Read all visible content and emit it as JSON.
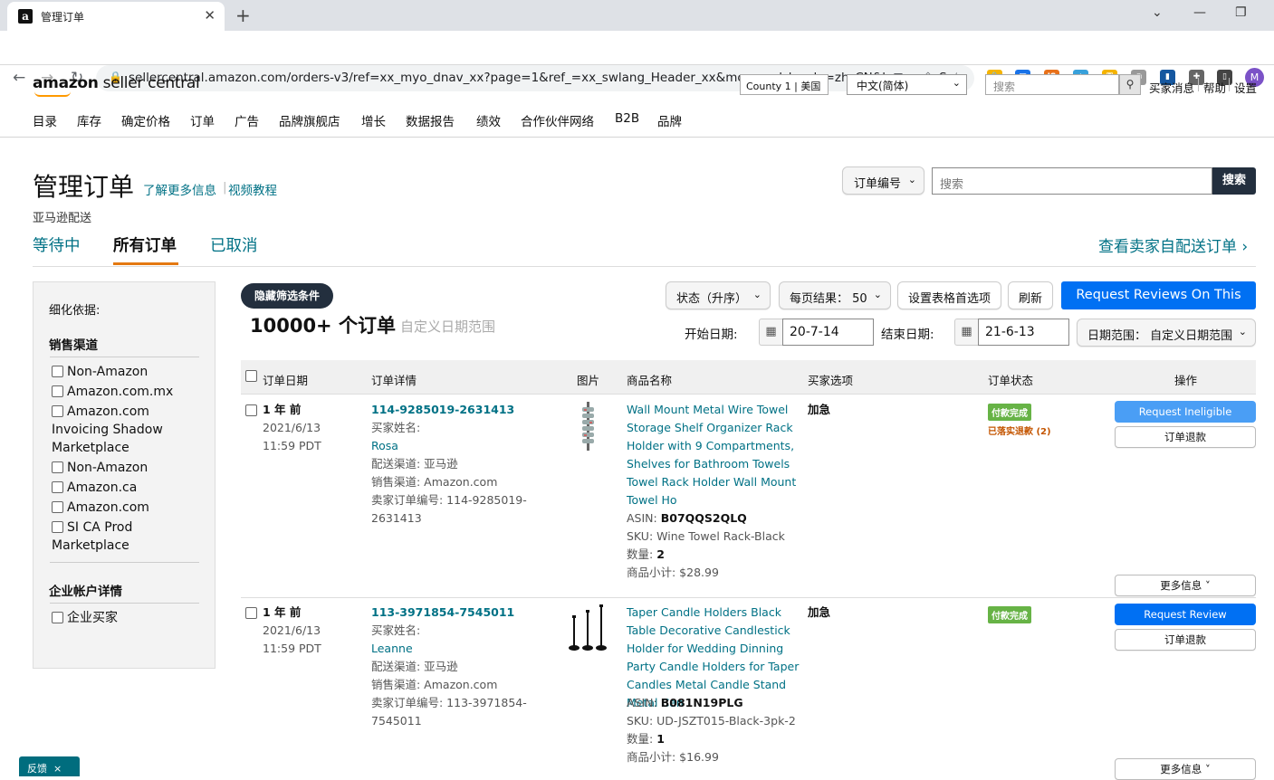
{
  "browser": {
    "tab_title": "管理订单",
    "favicon_letter": "a",
    "url": "sellercentral.amazon.com/orders-v3/ref=xx_myo_dnav_xx?page=1&ref_=xx_swlang_Header_xx&mons_sel_locale=zh_CN&languageS...",
    "profile_letter": "M"
  },
  "header": {
    "logo_amazon": "amazon",
    "logo_rest": " seller central",
    "county_label": "County 1 | 美国",
    "language": "中文(简体)",
    "search_placeholder": "搜索",
    "links": [
      "买家消息",
      "帮助",
      "设置"
    ]
  },
  "main_nav": [
    "目录",
    "库存",
    "确定价格",
    "订单",
    "广告",
    "品牌旗舰店",
    "增长",
    "数据报告",
    "绩效",
    "合作伙伴网络",
    "B2B",
    "品牌"
  ],
  "page": {
    "title": "管理订单",
    "learn_more": "了解更多信息",
    "video": "视频教程",
    "subtitle": "亚马逊配送",
    "tabs": [
      "等待中",
      "所有订单",
      "已取消"
    ],
    "view_fbm": "查看卖家自配送订单 ›",
    "search_type": "订单编号",
    "search_placeholder": "搜索",
    "search_button": "搜索"
  },
  "sidebar": {
    "refine_by": "细化依据:",
    "sales_channel_heading": "销售渠道",
    "channels": [
      "Non-Amazon",
      "Amazon.com.mx",
      "Amazon.com",
      "Invoicing Shadow",
      "Marketplace",
      "Non-Amazon",
      "Amazon.ca",
      "Amazon.com",
      "SI CA Prod",
      "Marketplace"
    ],
    "business_heading": "企业帐户详情",
    "business_option": "企业买家"
  },
  "results": {
    "hide_filters": "隐藏筛选条件",
    "order_count": "10000+ 个订单",
    "custom_range": "自定义日期范围",
    "sort": "状态（升序）",
    "per_page": "每页结果：  50",
    "table_prefs": "设置表格首选项",
    "refresh": "刷新",
    "request_reviews": "Request Reviews On This Page",
    "start_label": "开始日期:",
    "start_date": "20-7-14",
    "end_label": "结束日期:",
    "end_date": "21-6-13",
    "date_range": "日期范围：  自定义日期范围"
  },
  "table": {
    "headers": [
      "订单日期",
      "订单详情",
      "图片",
      "商品名称",
      "买家选项",
      "订单状态",
      "操作"
    ],
    "rows": [
      {
        "age": "1 年 前",
        "date": "2021/6/13",
        "time": "11:59 PDT",
        "order_id": "114-9285019-2631413",
        "buyer_label": "买家姓名:",
        "buyer": "Rosa",
        "fulfillment": "配送渠道: 亚马逊",
        "channel": "销售渠道: Amazon.com",
        "seller_order_label": "卖家订单编号: 114-9285019-",
        "seller_order_cont": "2631413",
        "product": "Wall Mount Metal Wire Towel Storage Shelf Organizer Rack Holder with 9 Compartments, Shelves for Bathroom Towels Towel Rack Holder Wall Mount Towel Ho",
        "asin_label": "ASIN: ",
        "asin": "B07QQS2QLQ",
        "sku": "SKU: Wine Towel Rack-Black",
        "qty_label": "数量: ",
        "qty": "2",
        "subtotal": "商品小计: $28.99",
        "buyer_option": "加急",
        "status": "付款完成",
        "refund": "已落实退款 (2)",
        "action_primary": "Request Ineligible",
        "action_refund": "订单退款",
        "more_info": "更多信息 ˅"
      },
      {
        "age": "1 年 前",
        "date": "2021/6/13",
        "time": "11:59 PDT",
        "order_id": "113-3971854-7545011",
        "buyer_label": "买家姓名:",
        "buyer": "Leanne",
        "fulfillment": "配送渠道: 亚马逊",
        "channel": "销售渠道: Amazon.com",
        "seller_order_label": "卖家订单编号: 113-3971854-",
        "seller_order_cont": "7545011",
        "product": "Taper Candle Holders Black Table Decorative Candlestick Holder for Wedding Dinning Party Candle Holders for Taper Candles Metal Candle Stand Metal Can",
        "asin_label": "ASIN: ",
        "asin": "B081N19PLG",
        "sku": "SKU: UD-JSZT015-Black-3pk-2",
        "qty_label": "数量: ",
        "qty": "1",
        "subtotal": "商品小计: $16.99",
        "buyer_option": "加急",
        "status": "付款完成",
        "action_primary": "Request Review",
        "action_refund": "订单退款",
        "more_info": "更多信息 ˅"
      }
    ]
  },
  "feedback": "反馈",
  "feedback_close": "×",
  "colors": {
    "link": "#007185",
    "primary_button": "#0070f3",
    "dark": "#232f3e",
    "accent": "#e47911",
    "status_green": "#67b346"
  }
}
